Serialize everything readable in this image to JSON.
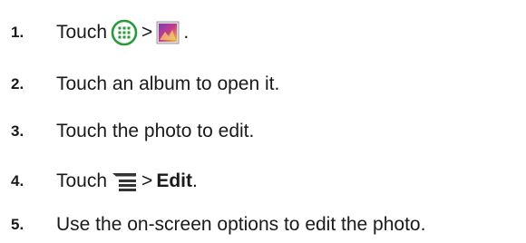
{
  "steps": [
    {
      "number": "1.",
      "parts": {
        "before": "Touch",
        "icon_a": "apps-grid-icon",
        "sep": ">",
        "icon_b": "gallery-icon",
        "after": "."
      }
    },
    {
      "number": "2.",
      "text": "Touch an album to open it."
    },
    {
      "number": "3.",
      "text": "Touch the photo to edit."
    },
    {
      "number": "4.",
      "parts": {
        "before": "Touch",
        "icon_a": "menu-icon",
        "sep": ">",
        "bold": "Edit",
        "after": "."
      }
    },
    {
      "number": "5.",
      "text": "Use the on-screen options to edit the photo."
    }
  ],
  "colors": {
    "text": "#1a1a1a",
    "icon_green": "#2a9a3a",
    "icon_dark": "#333333"
  }
}
